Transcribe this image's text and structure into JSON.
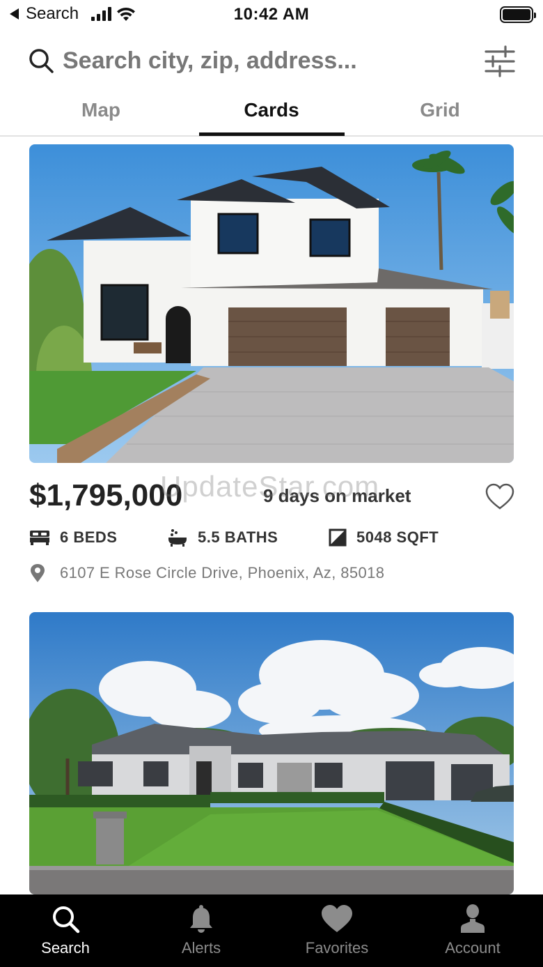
{
  "status_bar": {
    "back_label": "Search",
    "time": "10:42 AM"
  },
  "search": {
    "placeholder": "Search city, zip, address..."
  },
  "tabs": [
    {
      "label": "Map",
      "active": false
    },
    {
      "label": "Cards",
      "active": true
    },
    {
      "label": "Grid",
      "active": false
    }
  ],
  "listings": [
    {
      "price": "$1,795,000",
      "days_on_market": "9 days on market",
      "beds": "6 BEDS",
      "baths": "5.5 BATHS",
      "sqft": "5048 SQFT",
      "address": "6107 E Rose Circle Drive, Phoenix, Az, 85018",
      "favorited": false
    }
  ],
  "watermark": "UpdateStar.com",
  "bottom_nav": [
    {
      "label": "Search",
      "icon": "search-icon",
      "active": true
    },
    {
      "label": "Alerts",
      "icon": "bell-icon",
      "active": false
    },
    {
      "label": "Favorites",
      "icon": "heart-icon",
      "active": false
    },
    {
      "label": "Account",
      "icon": "person-icon",
      "active": false
    }
  ],
  "colors": {
    "active_tab": "#111111",
    "inactive_tab": "#8a8a8a",
    "bottom_bar": "#000000",
    "bottom_active": "#ffffff",
    "bottom_inactive": "#8c8c8c"
  }
}
